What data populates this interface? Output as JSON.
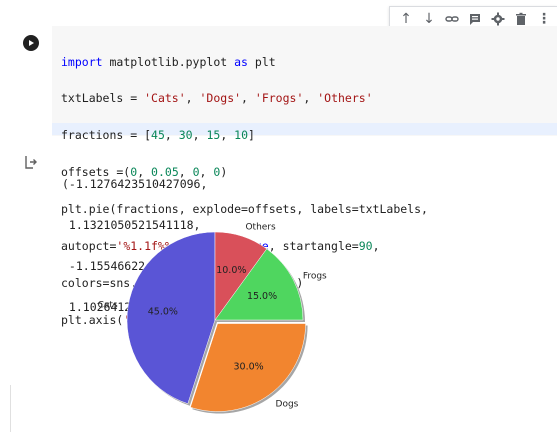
{
  "toolbar": {
    "icons": [
      "arrow-up-icon",
      "arrow-down-icon",
      "link-icon",
      "comment-icon",
      "gear-icon",
      "trash-icon",
      "more-vert-icon"
    ],
    "glyphs": [
      "↑",
      "↓",
      "⛓",
      "▤",
      "⚙",
      "🗑",
      "⋮"
    ]
  },
  "code": {
    "lines": [
      "import matplotlib.pyplot as plt",
      "txtLabels = 'Cats', 'Dogs', 'Frogs', 'Others'",
      "fractions = [45, 30, 15, 10]",
      "offsets =(0, 0.05, 0, 0)",
      "plt.pie(fractions, explode=offsets, labels=txtLabels,",
      "autopct='%1.1f%%', shadow=True, startangle=90,",
      "colors=sns.color_palette('muted') )",
      "plt.axis('equal')"
    ]
  },
  "output": {
    "lines": [
      "(-1.1276423510427096,",
      " 1.1321050521541118,",
      " -1.1554662242543934,",
      " 1.1026412539202821)"
    ]
  },
  "chart_data": {
    "type": "pie",
    "categories": [
      "Cats",
      "Dogs",
      "Frogs",
      "Others"
    ],
    "values": [
      45,
      30,
      15,
      10
    ],
    "percent_labels": [
      "45.0%",
      "30.0%",
      "15.0%",
      "10.0%"
    ],
    "explode": [
      0,
      0.05,
      0,
      0
    ],
    "startangle": 90,
    "shadow": true,
    "colors": [
      "#5a55d6",
      "#f2852f",
      "#4fd65f",
      "#d9505a"
    ]
  }
}
